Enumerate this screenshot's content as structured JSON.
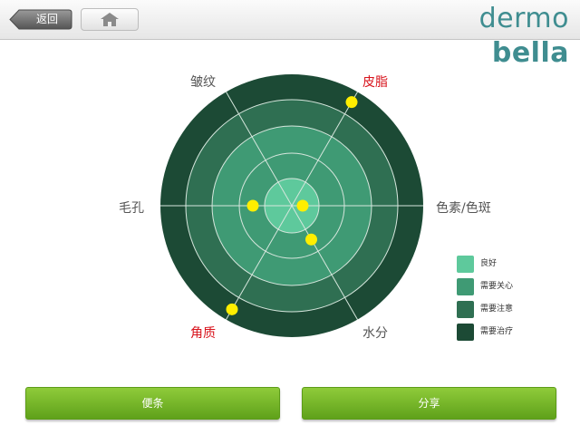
{
  "header": {
    "back_label": "返回",
    "brand_part1": "dermo ",
    "brand_part2": "bella",
    "brand_color": "#3f8d90",
    "home_icon": "home-icon"
  },
  "radar": {
    "axes": [
      {
        "label": "皱纹",
        "color": "#555555"
      },
      {
        "label": "皮脂",
        "color": "#d8141d"
      },
      {
        "label": "毛孔",
        "color": "#555555"
      },
      {
        "label": "色素/色斑",
        "color": "#555555"
      },
      {
        "label": "角质",
        "color": "#d8141d"
      },
      {
        "label": "水分",
        "color": "#555555"
      }
    ],
    "ring_colors": [
      "#5ec99c",
      "#3f9a74",
      "#2f6f52",
      "#1c4a35"
    ],
    "marker_color": "#ffee00",
    "scores": [
      {
        "axis": "皮脂",
        "level": 4
      },
      {
        "axis": "毛孔",
        "level": 2
      },
      {
        "axis": "色素/色斑",
        "level": 1
      },
      {
        "axis": "水分",
        "level": 2
      },
      {
        "axis": "角质",
        "level": 4
      }
    ]
  },
  "legend": {
    "items": [
      {
        "label": "良好",
        "color": "#5ec99c"
      },
      {
        "label": "需要关心",
        "color": "#3f9a74"
      },
      {
        "label": "需要注意",
        "color": "#2f6f52"
      },
      {
        "label": "需要治疗",
        "color": "#1c4a35"
      }
    ]
  },
  "footer": {
    "note_button": "便条",
    "share_button": "分享",
    "button_color": "#76b82a"
  }
}
